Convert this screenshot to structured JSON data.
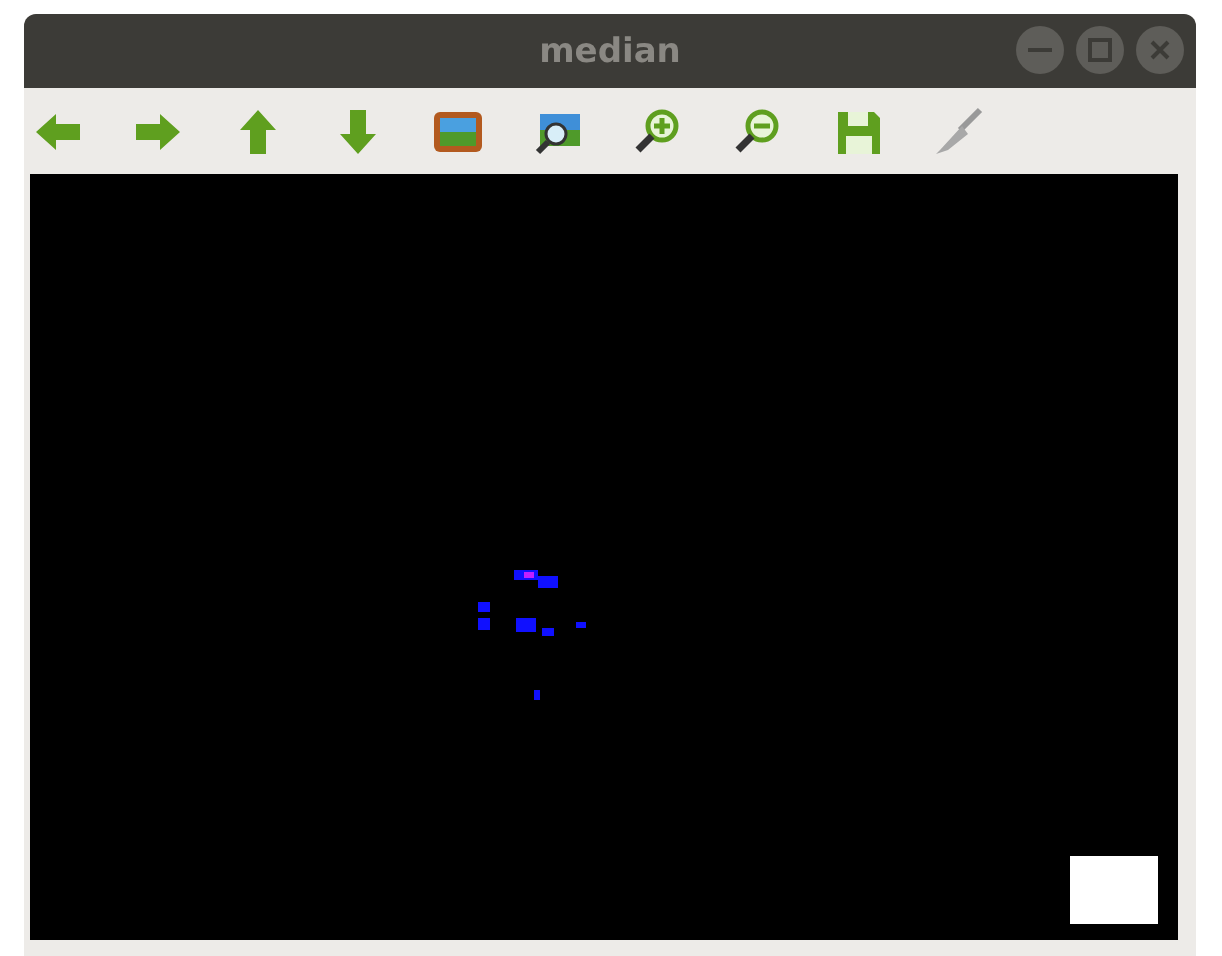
{
  "window": {
    "title": "median"
  }
}
